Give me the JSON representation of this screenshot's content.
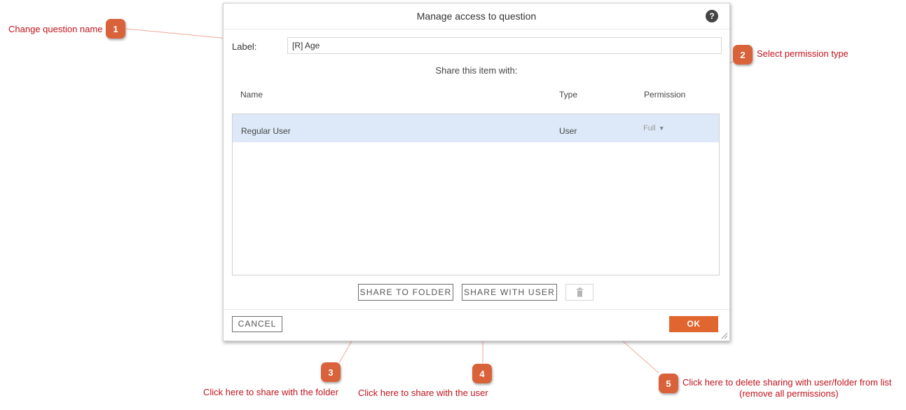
{
  "dialog": {
    "title": "Manage access to question",
    "help_icon": "?",
    "label_text": "Label:",
    "label_value": "[R] Age",
    "share_heading": "Share this item with:",
    "columns": {
      "name": "Name",
      "type": "Type",
      "permission": "Permission"
    },
    "rows": [
      {
        "name": "Regular User",
        "type": "User",
        "permission": "Full"
      }
    ],
    "buttons": {
      "share_folder": "SHARE TO FOLDER",
      "share_user": "SHARE WITH USER",
      "cancel": "CANCEL",
      "ok": "OK"
    }
  },
  "callouts": [
    {
      "number": "1",
      "text": "Change question name"
    },
    {
      "number": "2",
      "text": "Select permission type"
    },
    {
      "number": "3",
      "text": "Click here to share with the folder"
    },
    {
      "number": "4",
      "text": "Click here to share with the user"
    },
    {
      "number": "5",
      "text": "Click here to delete sharing with user/folder from list",
      "text2": "(remove all permissions)"
    }
  ],
  "colors": {
    "callout_text": "#c0141c",
    "badge": "#d9623a",
    "ok_button": "#e0652e",
    "selected_row": "#dde9f8"
  },
  "icons": [
    "help-icon",
    "trash-icon",
    "dropdown-arrow-icon",
    "resize-grip-icon"
  ]
}
